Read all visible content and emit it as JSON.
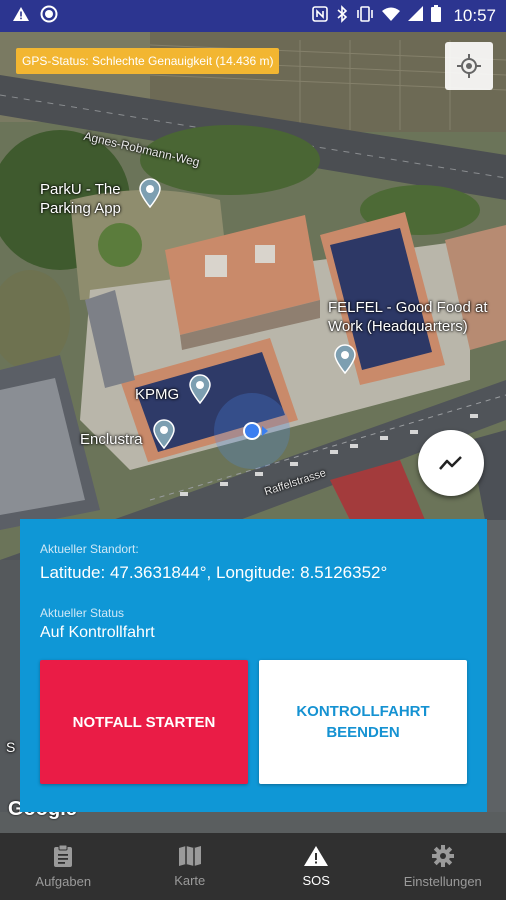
{
  "status_bar": {
    "time": "10:57",
    "icons": [
      "warning-icon",
      "circle-icon",
      "nfc-icon",
      "bluetooth-icon",
      "vibrate-icon",
      "wifi-icon",
      "signal-icon",
      "battery-icon"
    ]
  },
  "map": {
    "gps_status": "GPS-Status: Schlechte Genauigkeit (14.436 m)",
    "street_agnes": "Agnes-Robmann-Weg",
    "street_raffel": "Raffelstrasse",
    "poi_parku": "ParkU - The Parking App",
    "poi_felfel": "FELFEL - Good Food at Work (Headquarters)",
    "poi_kpmg": "KPMG",
    "poi_enclustra": "Enclustra",
    "attribution": "Google",
    "fragment_s": "S"
  },
  "panel": {
    "location_label": "Aktueller Standort:",
    "location_value": "Latitude: 47.3631844°, Longitude: 8.5126352°",
    "status_label": "Aktueller Status",
    "status_value": "Auf Kontrollfahrt",
    "emergency_button": "NOTFALL STARTEN",
    "end_button": "KONTROLLFAHRT BEENDEN"
  },
  "bottom_nav": {
    "items": [
      {
        "label": "Aufgaben",
        "icon": "clipboard-icon"
      },
      {
        "label": "Karte",
        "icon": "map-icon"
      },
      {
        "label": "SOS",
        "icon": "warning-icon"
      },
      {
        "label": "Einstellungen",
        "icon": "gear-icon"
      }
    ],
    "active": "SOS"
  },
  "colors": {
    "status_bar": "#2c3590",
    "panel": "#0f97d6",
    "emergency": "#ea1c46",
    "gps_chip": "#f2b631",
    "nav_bg": "#303030"
  }
}
